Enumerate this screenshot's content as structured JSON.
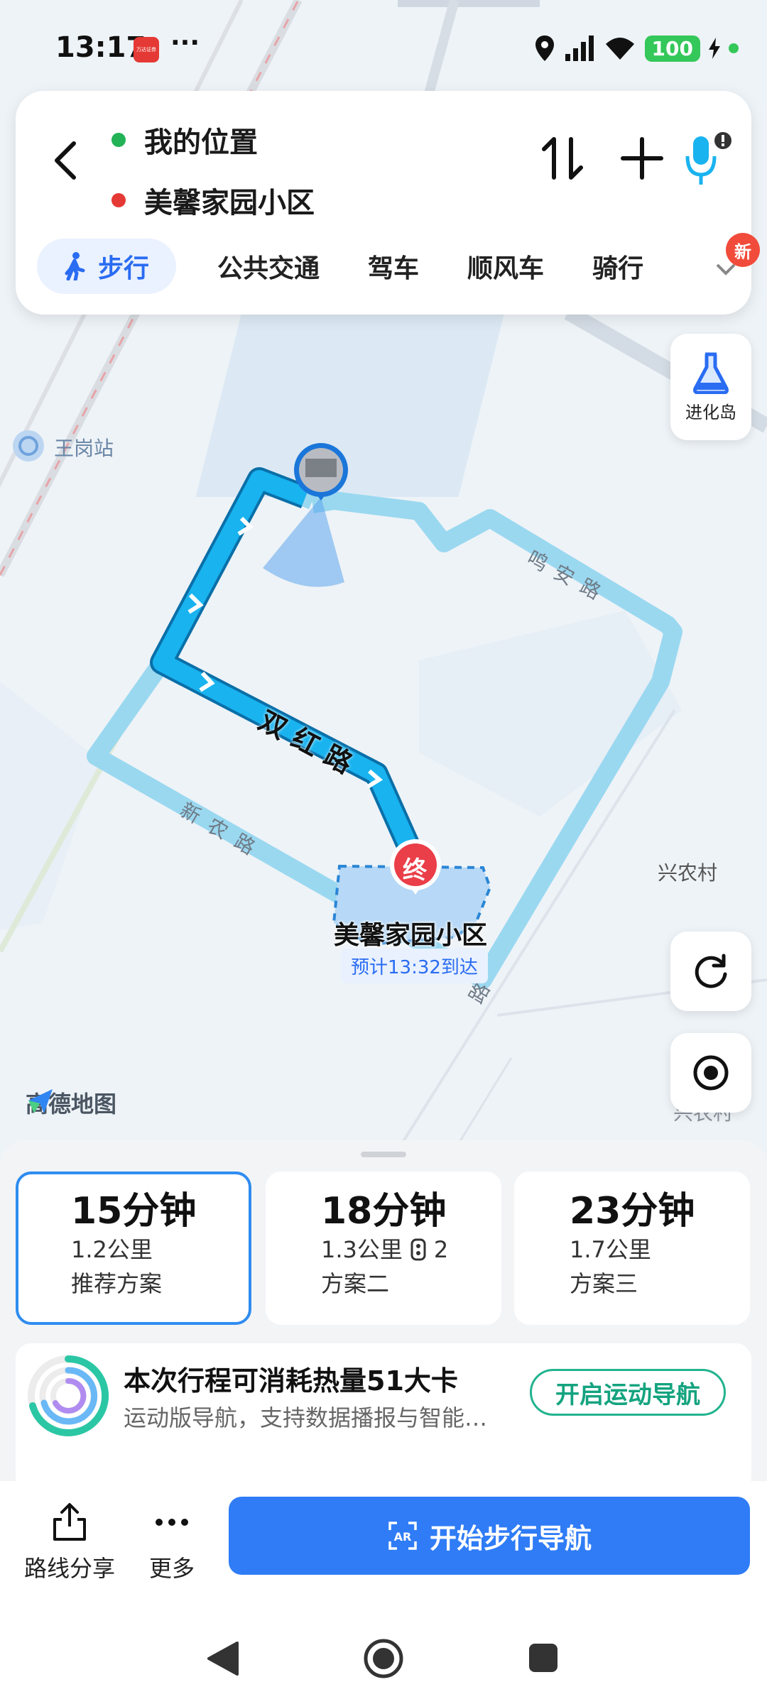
{
  "status_bar": {
    "time": "13:17",
    "app_badge": "万达证券",
    "more": "···",
    "battery": "100"
  },
  "search": {
    "origin": "我的位置",
    "destination": "美馨家园小区",
    "origin_color": "#22b357",
    "destination_color": "#e53935"
  },
  "modes": [
    {
      "label": "步行",
      "active": true
    },
    {
      "label": "公共交通"
    },
    {
      "label": "驾车"
    },
    {
      "label": "顺风车"
    },
    {
      "label": "骑行"
    }
  ],
  "new_badge": "新",
  "side_tools": {
    "evolution_island": "进化岛"
  },
  "map": {
    "station": "王岗站",
    "roads": [
      "双红路",
      "新农路",
      "鸣安路",
      "路"
    ],
    "village": "兴农村",
    "destination_marker": "终",
    "destination_name": "美馨家园小区",
    "eta": "预计13:32到达",
    "brand": "高德地图",
    "faded_label": "兴农村"
  },
  "routes": [
    {
      "time": "15分钟",
      "distance": "1.2公里",
      "tag": "推荐方案",
      "selected": true
    },
    {
      "time": "18分钟",
      "distance": "1.3公里",
      "lights": "2",
      "tag": "方案二"
    },
    {
      "time": "23分钟",
      "distance": "1.7公里",
      "tag": "方案三"
    }
  ],
  "promo": {
    "title": "本次行程可消耗热量51大卡",
    "subtitle": "运动版导航，支持数据播报与智能…",
    "button": "开启运动导航"
  },
  "footer": {
    "share": "路线分享",
    "more": "更多",
    "start": "开始步行导航",
    "ar": "AR"
  },
  "colors": {
    "accent": "#2f7cf6",
    "route_main": "#1aa6e8",
    "route_alt": "#9ad8f0",
    "green": "#21b38e"
  }
}
